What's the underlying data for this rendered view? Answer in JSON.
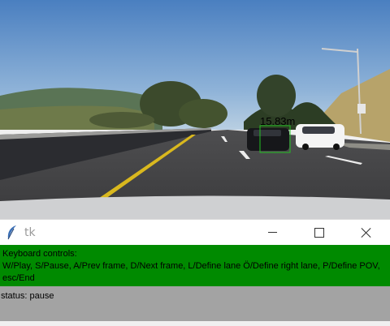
{
  "window": {
    "title": "tk",
    "icon": "feather-icon"
  },
  "window_controls": {
    "minimize": "minimize-icon",
    "maximize": "maximize-icon",
    "close": "close-icon"
  },
  "video": {
    "detection_label": "15.83m",
    "detection_box_color": "#22c022",
    "lane_line_color": "#e8c400"
  },
  "controls_panel": {
    "heading": "Keyboard controls:",
    "text": "W/Play, S/Pause, A/Prev frame, D/Next frame, L/Define lane Ö/Define right lane, P/Define POV, esc/End",
    "background": "#008a00"
  },
  "status": {
    "text": "status: pause",
    "background": "#a3a3a3"
  }
}
